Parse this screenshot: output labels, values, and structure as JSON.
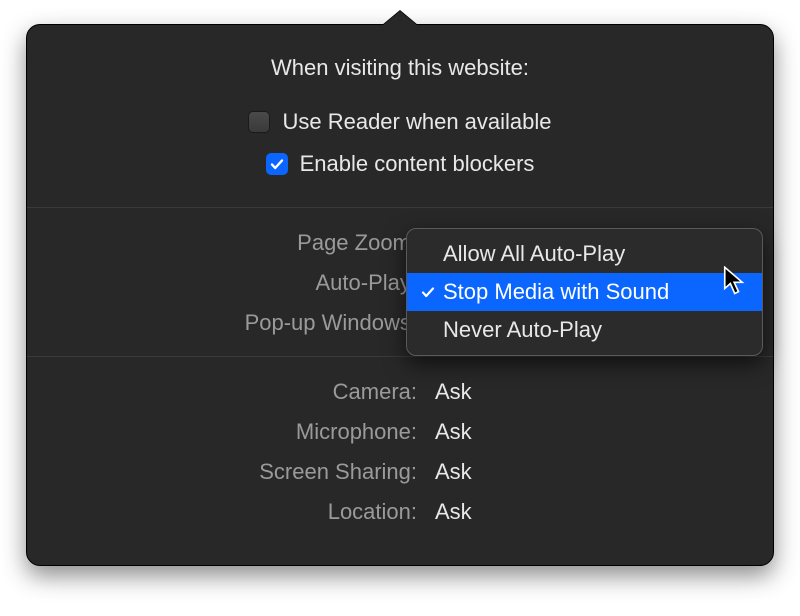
{
  "heading": "When visiting this website:",
  "checkboxes": {
    "reader": {
      "label": "Use Reader when available",
      "checked": false
    },
    "blockers": {
      "label": "Enable content blockers",
      "checked": true
    }
  },
  "settings_group1": {
    "page_zoom": {
      "label": "Page Zoom:"
    },
    "auto_play": {
      "label": "Auto-Play:"
    },
    "popups": {
      "label": "Pop-up Windows:"
    }
  },
  "autoplay_menu": {
    "items": [
      {
        "label": "Allow All Auto-Play"
      },
      {
        "label": "Stop Media with Sound"
      },
      {
        "label": "Never Auto-Play"
      }
    ],
    "selected_index": 1
  },
  "settings_group2": {
    "camera": {
      "label": "Camera:",
      "value": "Ask"
    },
    "mic": {
      "label": "Microphone:",
      "value": "Ask"
    },
    "screen": {
      "label": "Screen Sharing:",
      "value": "Ask"
    },
    "location": {
      "label": "Location:",
      "value": "Ask"
    }
  }
}
